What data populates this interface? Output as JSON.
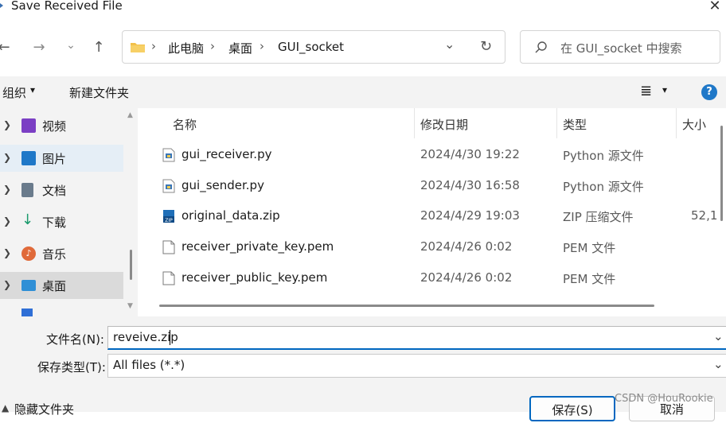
{
  "window": {
    "title": "Save Received File",
    "close_glyph": "✕"
  },
  "nav": {
    "back_glyph": "←",
    "forward_glyph": "→",
    "recent_glyph": "⌄",
    "up_glyph": "↑",
    "breadcrumb": [
      "此电脑",
      "桌面",
      "GUI_socket"
    ],
    "separator": "›",
    "dropdown_glyph": "⌄",
    "refresh_glyph": "↻",
    "search_placeholder": "在 GUI_socket 中搜索"
  },
  "toolbar": {
    "organize_label": "组织",
    "organize_caret": "▾",
    "new_folder_label": "新建文件夹",
    "view_glyph": "≣",
    "view_caret": "▾",
    "help_glyph": "?"
  },
  "sidebar": {
    "items": [
      {
        "label": "视频",
        "icon": "video-icon",
        "color": "#7b3fc4"
      },
      {
        "label": "图片",
        "icon": "pictures-icon",
        "color": "#1f78c8"
      },
      {
        "label": "文档",
        "icon": "documents-icon",
        "color": "#6a7b8c"
      },
      {
        "label": "下载",
        "icon": "downloads-icon",
        "color": "#1a9a6c"
      },
      {
        "label": "音乐",
        "icon": "music-icon",
        "color": "#e06a3a"
      },
      {
        "label": "桌面",
        "icon": "desktop-icon",
        "color": "#2f8fd6"
      }
    ]
  },
  "file_list": {
    "columns": [
      "名称",
      "修改日期",
      "类型",
      "大小"
    ],
    "rows": [
      {
        "name": "gui_receiver.py",
        "date": "2024/4/30 19:22",
        "type": "Python 源文件",
        "size": "",
        "icon": "python-file-icon"
      },
      {
        "name": "gui_sender.py",
        "date": "2024/4/30 16:58",
        "type": "Python 源文件",
        "size": "",
        "icon": "python-file-icon"
      },
      {
        "name": "original_data.zip",
        "date": "2024/4/29 19:03",
        "type": "ZIP 压缩文件",
        "size": "52,1",
        "icon": "zip-file-icon"
      },
      {
        "name": "receiver_private_key.pem",
        "date": "2024/4/26 0:02",
        "type": "PEM 文件",
        "size": "",
        "icon": "blank-file-icon"
      },
      {
        "name": "receiver_public_key.pem",
        "date": "2024/4/26 0:02",
        "type": "PEM 文件",
        "size": "",
        "icon": "blank-file-icon"
      }
    ]
  },
  "form": {
    "filename_label": "文件名(N):",
    "filename_value": "reveive.zip",
    "filetype_label": "保存类型(T):",
    "filetype_value": "All files (*.*)",
    "hide_folders_label": "隐藏文件夹",
    "save_label": "保存(S)",
    "cancel_label": "取消"
  },
  "watermark": "CSDN @HouRookie",
  "colors": {
    "accent": "#0067c0",
    "help": "#1f78c8"
  }
}
